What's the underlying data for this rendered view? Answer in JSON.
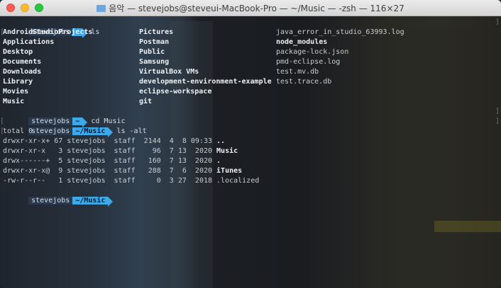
{
  "window": {
    "title": "음악 — stevejobs@steveui-MacBook-Pro — ~/Music — -zsh — 116×27"
  },
  "prompt": {
    "user": "stevejobs",
    "home_dir": "~",
    "music_dir": "~/Music"
  },
  "commands": {
    "ls": "ls",
    "cd": "cd Music",
    "ls_alt": "ls -alt"
  },
  "ls_output": {
    "col1": [
      {
        "name": "AndroidStudioProjects",
        "bold": true
      },
      {
        "name": "Applications",
        "bold": true
      },
      {
        "name": "Desktop",
        "bold": true
      },
      {
        "name": "Documents",
        "bold": true
      },
      {
        "name": "Downloads",
        "bold": true
      },
      {
        "name": "Library",
        "bold": true
      },
      {
        "name": "Movies",
        "bold": true
      },
      {
        "name": "Music",
        "bold": true
      }
    ],
    "col2": [
      {
        "name": "Pictures",
        "bold": true
      },
      {
        "name": "Postman",
        "bold": true
      },
      {
        "name": "Public",
        "bold": true
      },
      {
        "name": "Samsung",
        "bold": true
      },
      {
        "name": "VirtualBox VMs",
        "bold": true
      },
      {
        "name": "development-environment-example",
        "bold": true
      },
      {
        "name": "eclipse-workspace",
        "bold": true
      },
      {
        "name": "git",
        "bold": true
      }
    ],
    "col3": [
      {
        "name": "java_error_in_studio_63993.log",
        "bold": false
      },
      {
        "name": "node_modules",
        "bold": true
      },
      {
        "name": "package-lock.json",
        "bold": false
      },
      {
        "name": "pmd-eclipse.log",
        "bold": false
      },
      {
        "name": "test.mv.db",
        "bold": false
      },
      {
        "name": "test.trace.db",
        "bold": false
      }
    ]
  },
  "ls_alt_output": {
    "total": "total 0",
    "rows": [
      {
        "meta": "drwxr-xr-x+ 67 stevejobs  staff  2144  4  8 09:33 ",
        "name": "..",
        "bold": true
      },
      {
        "meta": "drwxr-xr-x   3 stevejobs  staff    96  7 13  2020 ",
        "name": "Music",
        "bold": true
      },
      {
        "meta": "drwx------+  5 stevejobs  staff   160  7 13  2020 ",
        "name": ".",
        "bold": true
      },
      {
        "meta": "drwxr-xr-x@  9 stevejobs  staff   288  7  6  2020 ",
        "name": "iTunes",
        "bold": true
      },
      {
        "meta": "-rw-r--r--   1 stevejobs  staff     0  3 27  2018 ",
        "name": ".localized",
        "bold": false
      }
    ]
  },
  "colors": {
    "prompt_dir_bg": "#3fa8e8",
    "prompt_user_bg": "#2a3a4c",
    "text": "#cfd3d7",
    "bold_text": "#eef1f4"
  }
}
